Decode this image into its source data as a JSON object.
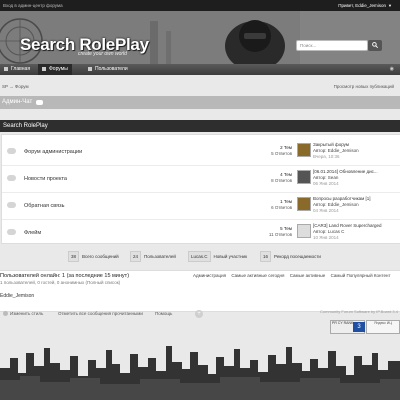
{
  "topbar": {
    "left_text": "Вход в админ-центр форума",
    "user_text": "Привет, Eddie_Jemison"
  },
  "header": {
    "site_title": "Search RolePlay",
    "tagline": "create your own world",
    "search_placeholder": "Поиск..."
  },
  "nav": {
    "items": [
      {
        "label": "Главная"
      },
      {
        "label": "Форумы"
      },
      {
        "label": "Пользователи"
      }
    ]
  },
  "breadcrumb": {
    "path": "SP → Форум",
    "right_link": "Просмотр новых публикаций"
  },
  "admin_strip": {
    "label": "Админ-Чат"
  },
  "category": {
    "title": "Search RolePlay",
    "forums": [
      {
        "title": "Форум администрации",
        "topics": "2 Тем",
        "replies": "5 Ответов",
        "last_title": "Закрытый форум",
        "last_author": "Автор: Eddie_Jemison",
        "last_date": "Вчера, 10:36"
      },
      {
        "title": "Новости проекта",
        "topics": "4 Тем",
        "replies": "8 Ответов",
        "last_title": "[06.01.2014] Обновление дис...",
        "last_author": "Автор: Sean",
        "last_date": "06 Янв 2014"
      },
      {
        "title": "Обратная связь",
        "topics": "1 Тем",
        "replies": "6 Ответов",
        "last_title": "Вопросы разработчикам [1]",
        "last_author": "Автор: Eddie_Jemison",
        "last_date": "04 Янв 2014"
      },
      {
        "title": "Флейм",
        "topics": "5 Тем",
        "replies": "11 Ответов",
        "last_title": "[CAR3] Land Rover Supercharged",
        "last_author": "Автор: Lucas C",
        "last_date": "10 Янв 2014"
      }
    ]
  },
  "summary": {
    "posts_count": "38",
    "posts_label": "Всего сообщений",
    "users_count": "24",
    "users_label": "Пользователей",
    "newest_name": "Lucas.C",
    "newest_label": "Новый участник",
    "record_count": "16",
    "record_label": "Рекорд посещаемости"
  },
  "online": {
    "heading": "Пользователей онлайн: 1 (за последние 15 минут)",
    "sub": "1 пользователей, 0 гостей, 0 анонимных (Полный список)",
    "user": "Eddie_Jemison",
    "links": [
      "Администрация",
      "Самые активные сегодня",
      "Самые активные",
      "Самый Популярный Контент"
    ]
  },
  "footer": {
    "change_style": "Изменить стиль",
    "mark_read": "Отметить все сообщения прочитанными",
    "help": "Помощь",
    "powered": "Community Forum Software by IP.Board 3.4"
  },
  "badges": {
    "pr_label": "PR CY RANK",
    "pr_value": "3",
    "cy_label": "Яндекс ИЦ"
  }
}
